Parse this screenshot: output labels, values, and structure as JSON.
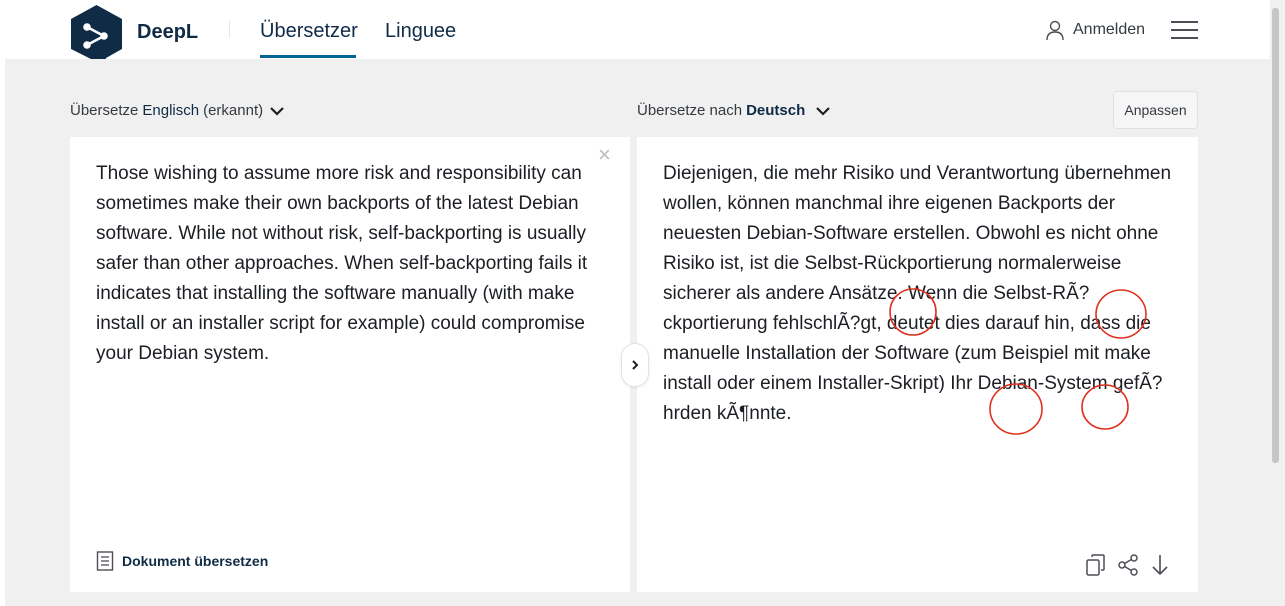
{
  "header": {
    "brand": "DeepL",
    "tabs": [
      {
        "label": "Übersetzer",
        "active": true
      },
      {
        "label": "Linguee",
        "active": false
      }
    ],
    "login_label": "Anmelden",
    "accent_color": "#006494",
    "brand_color": "#0f2b46"
  },
  "source": {
    "lang_prefix": "Übersetze",
    "lang_name": "Englisch",
    "lang_suffix": "(erkannt)",
    "text": "Those wishing to assume more risk and responsibility can sometimes make their own backports of the latest Debian software. While not without risk, self-backporting is usually safer than other approaches. When self-backporting fails it indicates that installing the software manually (with make install or an installer script for example) could compromise your Debian system.",
    "clear_icon": "×",
    "doc_translate_label": "Dokument übersetzen"
  },
  "target": {
    "lang_prefix": "Übersetze nach",
    "lang_name": "Deutsch",
    "adapt_label": "Anpassen",
    "text": "Diejenigen, die mehr Risiko und Verantwortung übernehmen wollen, können manchmal ihre eigenen Backports der neuesten Debian-Software erstellen. Obwohl es nicht ohne Risiko ist, ist die Selbst-Rückportierung normalerweise sicherer als andere Ansätze. Wenn die Selbst-RÃ?ckportierung fehlschlÃ?gt, deutet dies darauf hin, dass die manuelle Installation der Software (zum Beispiel mit make install oder einem Installer-Skript) Ihr Debian-System gefÃ?hrden kÃ¶nnte."
  },
  "icons": {
    "logo": "deepl-logo-icon",
    "user": "user-icon",
    "menu": "hamburger-menu-icon",
    "swap": "chevron-right-icon",
    "document": "document-icon",
    "copy": "copy-icon",
    "share": "share-icon",
    "download": "download-icon"
  },
  "annotation_color": "#e0301e"
}
